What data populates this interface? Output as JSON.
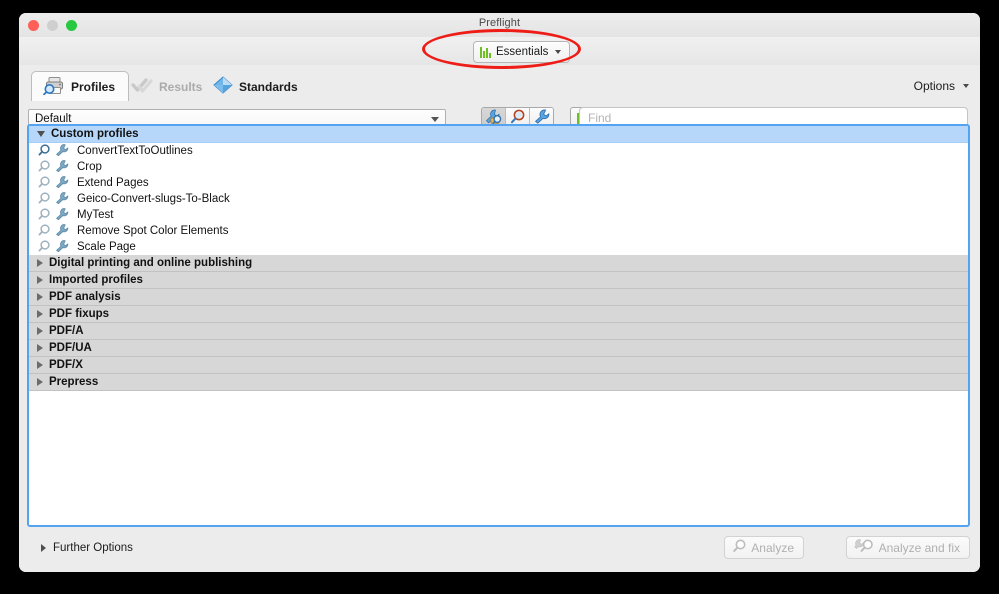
{
  "window": {
    "title": "Preflight",
    "traffic_lights": [
      "close-button",
      "minimize-button",
      "maximize-button"
    ]
  },
  "workspace": {
    "label": "Essentials",
    "icon": "bar-chart-icon",
    "dropdown_icon": "chevron-down-icon",
    "highlight_color": "#ee1c16"
  },
  "tabs": [
    {
      "label": "Profiles",
      "icon": "printer-magnifier-icon",
      "state": "active"
    },
    {
      "label": "Results",
      "icon": "checkmarks-icon",
      "state": "disabled"
    },
    {
      "label": "Standards",
      "icon": "blue-diamond-icon",
      "state": "enabled"
    }
  ],
  "options_menu": {
    "label": "Options",
    "icon": "chevron-down-icon"
  },
  "filter_bar": {
    "profile_select_value": "Default",
    "buttons": [
      {
        "name": "edit-profile-button",
        "icon": "wrench-magnifier-icon",
        "state": "pressed"
      },
      {
        "name": "inspect-button",
        "icon": "magnifier-icon",
        "state": "normal"
      },
      {
        "name": "fixup-button",
        "icon": "wrench-icon",
        "state": "normal"
      },
      {
        "name": "report-button",
        "icon": "bar-chart-icon",
        "state": "normal"
      }
    ],
    "find_placeholder": "Find",
    "find_value": ""
  },
  "profile_list": {
    "groups": [
      {
        "label": "Custom profiles",
        "expanded": true,
        "selected": true,
        "items": [
          {
            "label": "ConvertTextToOutlines",
            "analyze_icon": "magnifier-icon-active",
            "fix_icon": "wrench-icon"
          },
          {
            "label": "Crop",
            "analyze_icon": "magnifier-icon",
            "fix_icon": "wrench-icon"
          },
          {
            "label": "Extend Pages",
            "analyze_icon": "magnifier-icon",
            "fix_icon": "wrench-icon"
          },
          {
            "label": "Geico-Convert-slugs-To-Black",
            "analyze_icon": "magnifier-icon",
            "fix_icon": "wrench-icon"
          },
          {
            "label": "MyTest",
            "analyze_icon": "magnifier-icon",
            "fix_icon": "wrench-icon"
          },
          {
            "label": "Remove Spot Color Elements",
            "analyze_icon": "magnifier-icon",
            "fix_icon": "wrench-icon"
          },
          {
            "label": "Scale Page",
            "analyze_icon": "magnifier-icon",
            "fix_icon": "wrench-icon"
          }
        ]
      },
      {
        "label": "Digital printing and online publishing",
        "expanded": false,
        "selected": false,
        "items": []
      },
      {
        "label": "Imported profiles",
        "expanded": false,
        "selected": false,
        "items": []
      },
      {
        "label": "PDF analysis",
        "expanded": false,
        "selected": false,
        "items": []
      },
      {
        "label": "PDF fixups",
        "expanded": false,
        "selected": false,
        "items": []
      },
      {
        "label": "PDF/A",
        "expanded": false,
        "selected": false,
        "items": []
      },
      {
        "label": "PDF/UA",
        "expanded": false,
        "selected": false,
        "items": []
      },
      {
        "label": "PDF/X",
        "expanded": false,
        "selected": false,
        "items": []
      },
      {
        "label": "Prepress",
        "expanded": false,
        "selected": false,
        "items": []
      }
    ]
  },
  "footer": {
    "further_options_label": "Further Options",
    "further_options_icon": "triangle-right-icon",
    "analyze_button": {
      "label": "Analyze",
      "icon": "magnifier-icon",
      "state": "disabled"
    },
    "analyze_fix_button": {
      "label": "Analyze and fix",
      "icon": "wrench-magnifier-icon",
      "state": "disabled"
    }
  }
}
